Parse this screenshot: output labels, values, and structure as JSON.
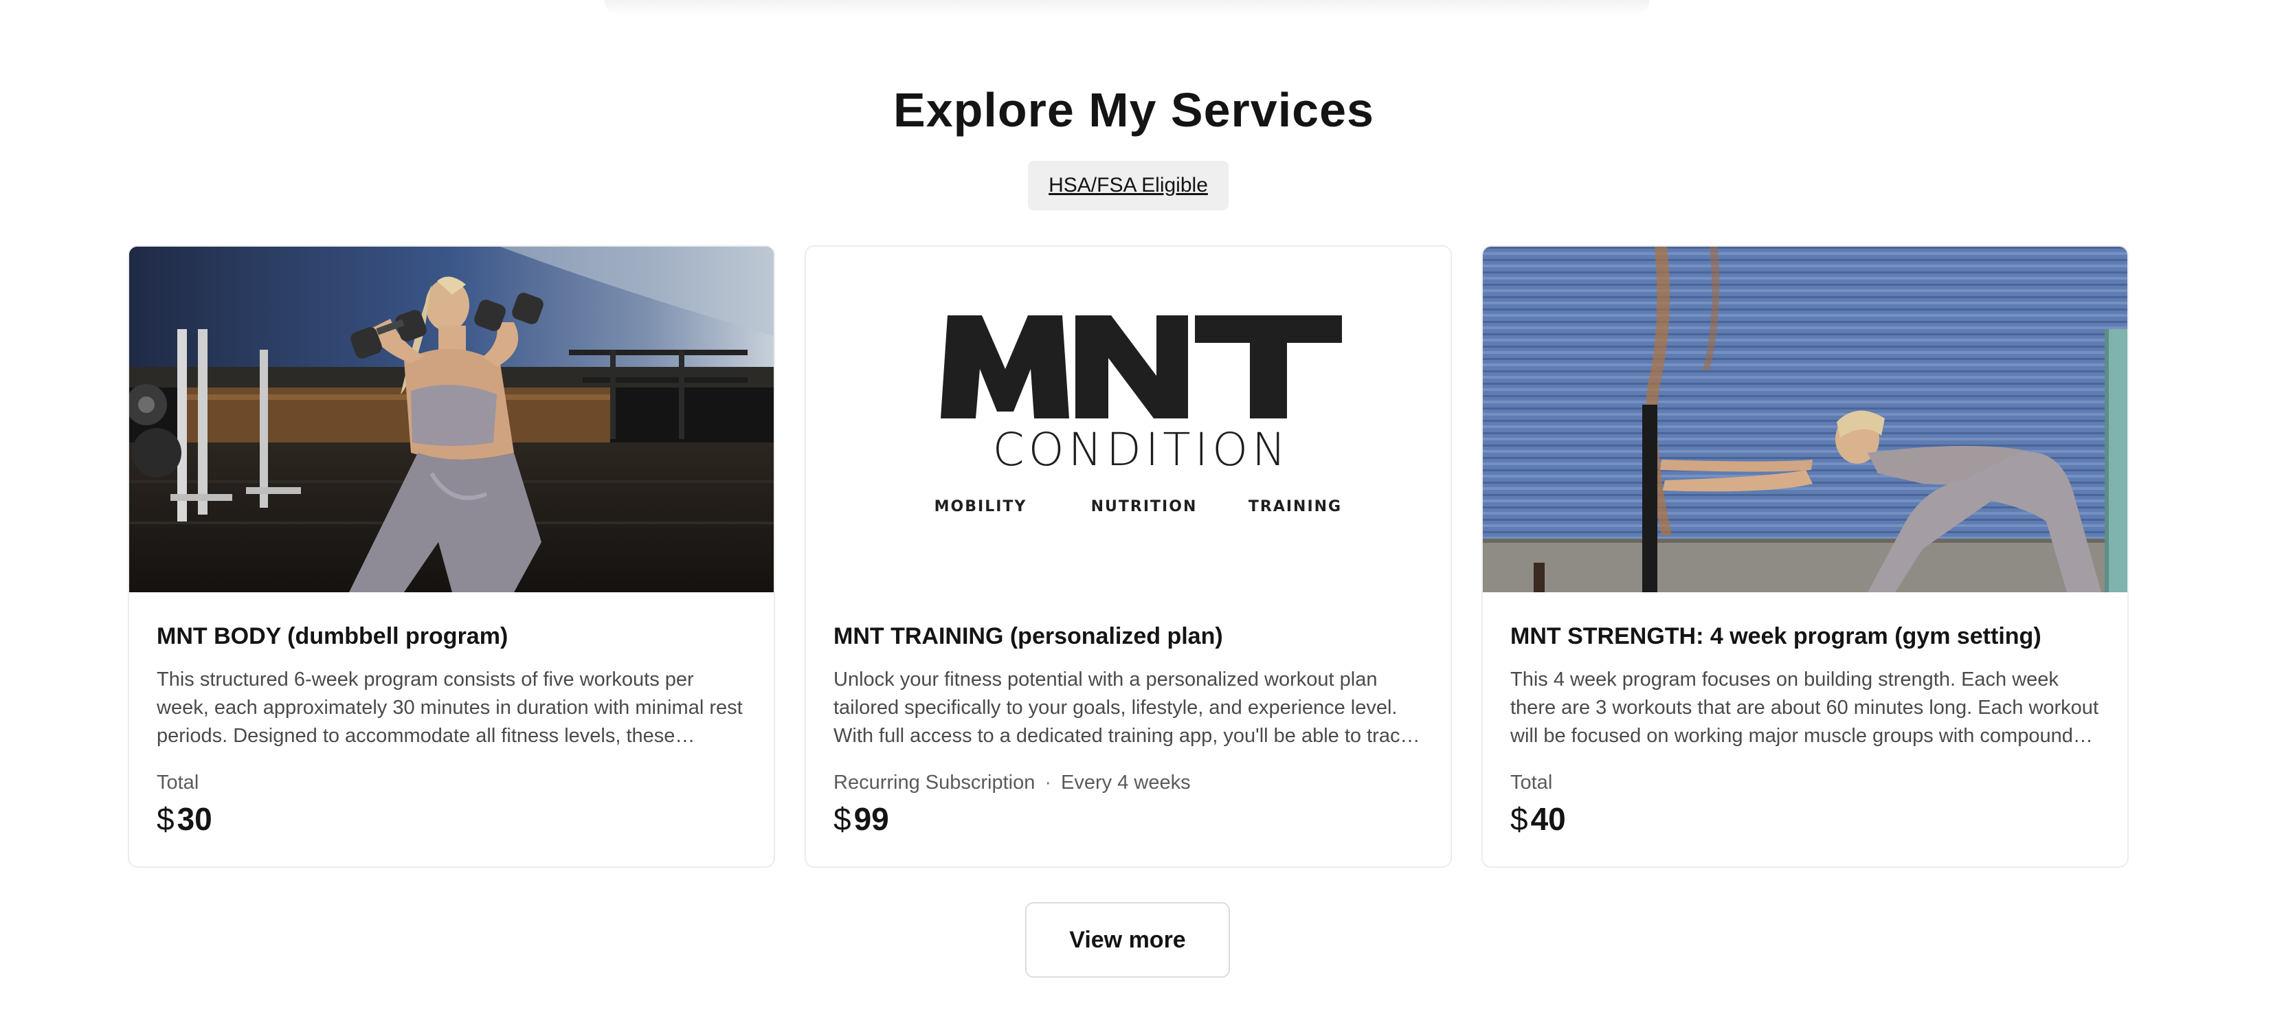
{
  "section": {
    "title": "Explore My Services",
    "badge": "HSA/FSA Eligible"
  },
  "cards": [
    {
      "title": "MNT BODY (dumbbell program)",
      "description": "This structured 6-week program consists of five workouts per week, each approximately 30 minutes in duration with minimal rest periods. Designed to accommodate all fitness levels, these workouts can be modified to suit your needs.",
      "meta": "Total",
      "currency": "$",
      "price": "30"
    },
    {
      "title": "MNT TRAINING (personalized plan)",
      "description": "Unlock your fitness potential with a personalized workout plan tailored specifically to your goals, lifestyle, and experience level. With full access to a dedicated training app, you'll be able to track your progress every step of the way.",
      "meta": "Recurring Subscription",
      "meta_extra": "Every 4 weeks",
      "currency": "$",
      "price": "99",
      "logo": {
        "brand": "MNT",
        "sub": "CONDITION",
        "tags": [
          "MOBILITY",
          "NUTRITION",
          "TRAINING"
        ]
      }
    },
    {
      "title": "MNT STRENGTH: 4 week program (gym setting)",
      "description": "This 4 week program focuses on building strength. Each week there are 3 workouts that are about 60 minutes long. Each workout will be focused on working major muscle groups with compound lifts and accessory movements.",
      "meta": "Total",
      "currency": "$",
      "price": "40"
    }
  ],
  "actions": {
    "view_more": "View more"
  },
  "colors": {
    "text": "#141414",
    "muted": "#4a4a4a",
    "badge_bg": "#efefef",
    "border": "#ececec"
  }
}
